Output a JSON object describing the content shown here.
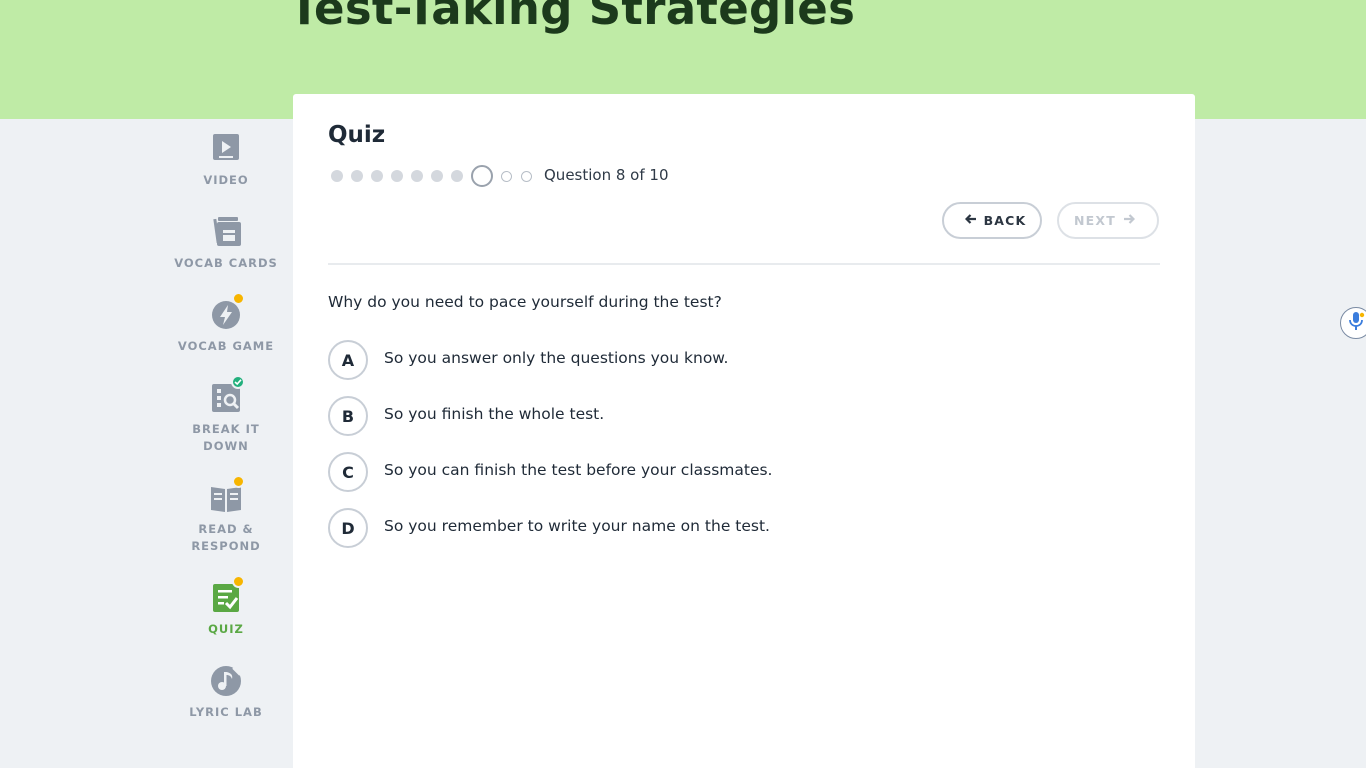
{
  "page": {
    "title": "Test-Taking Strategies"
  },
  "colors": {
    "hero_bg": "#bfeba6",
    "active_green": "#5aa844",
    "badge_orange": "#f7b500",
    "badge_teal": "#22b07d"
  },
  "sidebar": {
    "items": [
      {
        "label": "VIDEO",
        "icon": "video-icon",
        "badge": null,
        "active": false
      },
      {
        "label": "VOCAB CARDS",
        "icon": "vocab-cards-icon",
        "badge": null,
        "active": false
      },
      {
        "label": "VOCAB GAME",
        "icon": "lightning-icon",
        "badge": "dot",
        "active": false
      },
      {
        "label": "BREAK IT DOWN",
        "icon": "break-it-down-icon",
        "badge": "check",
        "active": false
      },
      {
        "label": "READ & RESPOND",
        "icon": "book-icon",
        "badge": "dot",
        "active": false
      },
      {
        "label": "QUIZ",
        "icon": "quiz-icon",
        "badge": "dot",
        "active": true
      },
      {
        "label": "LYRIC LAB",
        "icon": "music-note-icon",
        "badge": null,
        "active": false
      }
    ]
  },
  "quiz": {
    "title": "Quiz",
    "progress": {
      "current": 8,
      "total": 10,
      "label": "Question 8 of 10"
    },
    "back_label": "BACK",
    "next_label": "NEXT",
    "question": "Why do you need to pace yourself during the test?",
    "answers": [
      {
        "letter": "A",
        "text": "So you answer only the questions you know."
      },
      {
        "letter": "B",
        "text": "So you finish the whole test."
      },
      {
        "letter": "C",
        "text": "So you can finish the test before your classmates."
      },
      {
        "letter": "D",
        "text": "So you remember to write your name on the test."
      }
    ]
  }
}
